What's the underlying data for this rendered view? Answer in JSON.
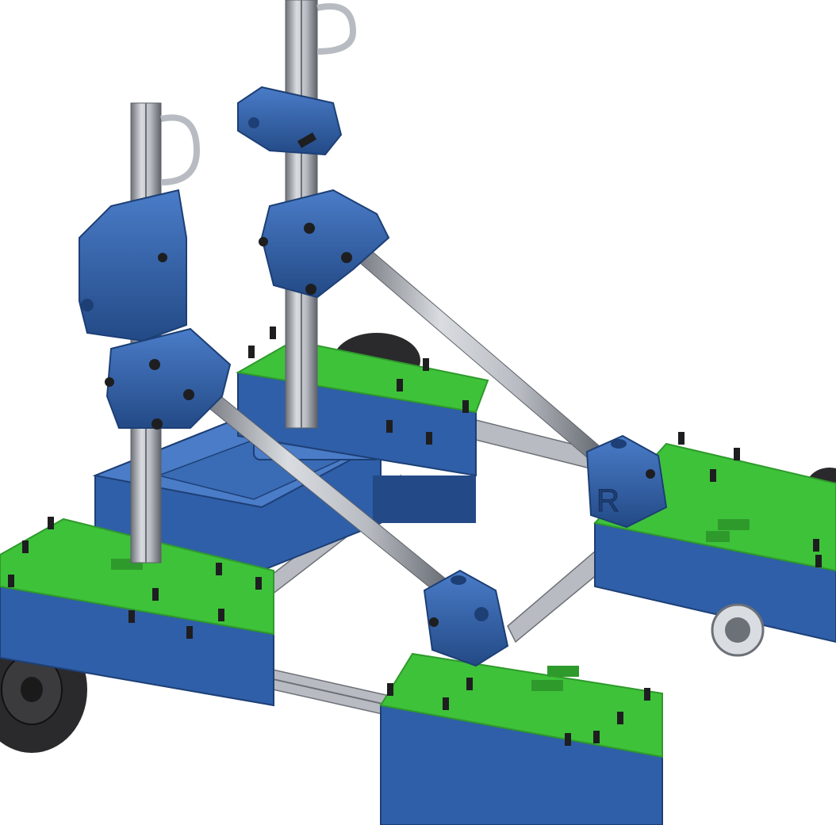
{
  "scene": {
    "subject": "cad-render-robot-chassis",
    "colors": {
      "background": "#ffffff",
      "plate_green": "#3ec23a",
      "plate_green_edge": "#2f9a2c",
      "housing_blue": "#2f5fa8",
      "housing_blue_dark": "#234a86",
      "housing_blue_light": "#4a7cc8",
      "extrusion_silver": "#b8bcc2",
      "extrusion_dark": "#6c7077",
      "wheel_black": "#2a2a2c",
      "bolt_black": "#1e1e20"
    }
  },
  "labels": {
    "corner_mark": "R"
  }
}
